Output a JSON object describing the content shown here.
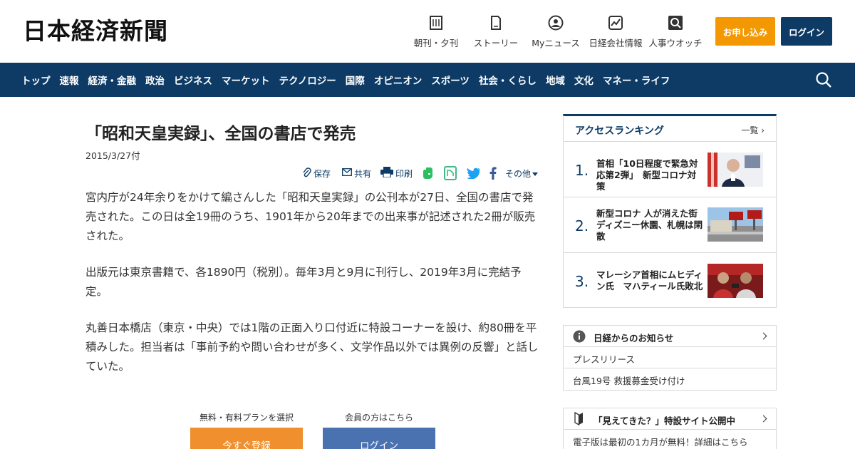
{
  "header": {
    "logo": "日本経済新聞",
    "nav": [
      {
        "label": "朝刊・夕刊",
        "icon": "newspaper-icon"
      },
      {
        "label": "ストーリー",
        "icon": "document-icon"
      },
      {
        "label": "Myニュース",
        "icon": "user-icon"
      },
      {
        "label": "日経会社情報",
        "icon": "chart-icon"
      },
      {
        "label": "人事ウオッチ",
        "icon": "magnifier-icon"
      }
    ],
    "subscribe_label": "お申し込み",
    "login_label": "ログイン"
  },
  "navbar": {
    "items": [
      "トップ",
      "速報",
      "経済・金融",
      "政治",
      "ビジネス",
      "マーケット",
      "テクノロジー",
      "国際",
      "オピニオン",
      "スポーツ",
      "社会・くらし",
      "地域",
      "文化",
      "マネー・ライフ"
    ]
  },
  "article": {
    "title": "「昭和天皇実録」、全国の書店で発売",
    "date": "2015/3/27付",
    "tools": {
      "save": "保存",
      "share": "共有",
      "print": "印刷",
      "more": "その他"
    },
    "paragraphs": [
      "宮内庁が24年余りをかけて編さんした「昭和天皇実録」の公刊本が27日、全国の書店で発売された。この日は全19冊のうち、1901年から20年までの出来事が記述された2冊が販売された。",
      "出版元は東京書籍で、各1890円（税別）。毎年3月と9月に刊行し、2019年3月に完結予定。",
      "丸善日本橋店（東京・中央）では1階の正面入り口付近に特設コーナーを設け、約80冊を平積みした。担当者は「事前予約や問い合わせが多く、文学作品以外では異例の反響」と話していた。"
    ],
    "cta": {
      "plan_label": "無料・有料プランを選択",
      "register_label": "今すぐ登録",
      "member_label": "会員の方はこちら",
      "login_label": "ログイン"
    }
  },
  "ranking": {
    "title": "アクセスランキング",
    "more": "一覧",
    "items": [
      {
        "num": "1.",
        "text": "首相「10日程度で緊急対応第2弾」　新型コロナ対策"
      },
      {
        "num": "2.",
        "text": "新型コロナ 人が消えた街 ディズニー休園、札幌は閑散"
      },
      {
        "num": "3.",
        "text": "マレーシア首相にムヒディン氏　マハティール氏敗北"
      }
    ]
  },
  "info": {
    "title": "日経からのお知らせ",
    "rows": [
      "プレスリリース",
      "台風19号 救援募金受け付け"
    ]
  },
  "promo": {
    "title": "「見えてきた？」特設サイト公開中",
    "text": "電子版は最初の1カ月が無料！詳細はこちら"
  },
  "colors": {
    "brand": "#0d3b66",
    "accent": "#f39800",
    "register": "#ef8f2e",
    "login": "#4a72b0"
  }
}
